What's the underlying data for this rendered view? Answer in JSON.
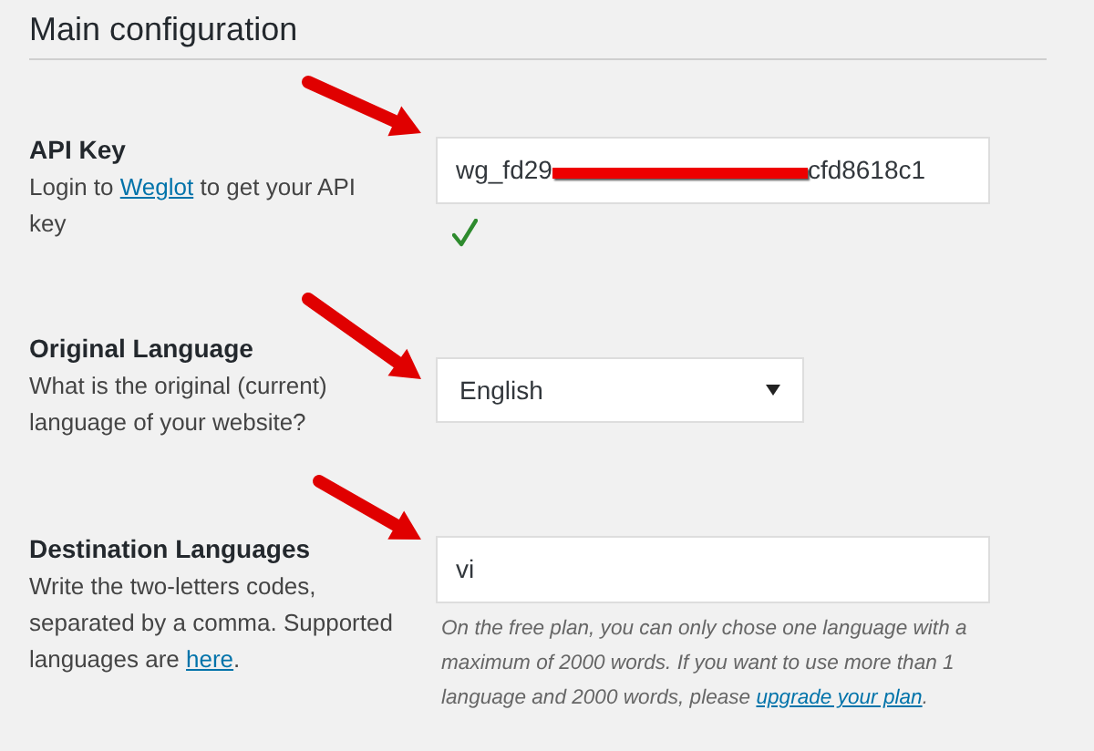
{
  "section_title": "Main configuration",
  "fields": [
    {
      "kind": "text",
      "label": "API Key",
      "description": [
        {
          "kind": "text",
          "text": "Login to "
        },
        {
          "kind": "link",
          "text": "Weglot"
        },
        {
          "kind": "text",
          "text": " to get your API key"
        }
      ],
      "value_start": "wg_fd29",
      "value_end": "cfd8618c1",
      "redacted": true,
      "valid": true,
      "arrow": true
    },
    {
      "kind": "select",
      "label": "Original Language",
      "description": [
        {
          "kind": "text",
          "text": "What is the original (current) language of your website?"
        }
      ],
      "value": "English",
      "arrow": true
    },
    {
      "kind": "text",
      "label": "Destination Languages",
      "description": [
        {
          "kind": "text",
          "text": "Write the two-letters codes, separated by a comma. Supported languages are "
        },
        {
          "kind": "link",
          "text": "here"
        },
        {
          "kind": "text",
          "text": "."
        }
      ],
      "value": "vi",
      "note": [
        {
          "kind": "text",
          "text": "On the free plan, you can only chose one language with a maximum of 2000 words. If you want to use more than 1 language and 2000 words, please "
        },
        {
          "kind": "link",
          "text": "upgrade your plan"
        },
        {
          "kind": "text",
          "text": "."
        }
      ],
      "arrow": true
    }
  ]
}
